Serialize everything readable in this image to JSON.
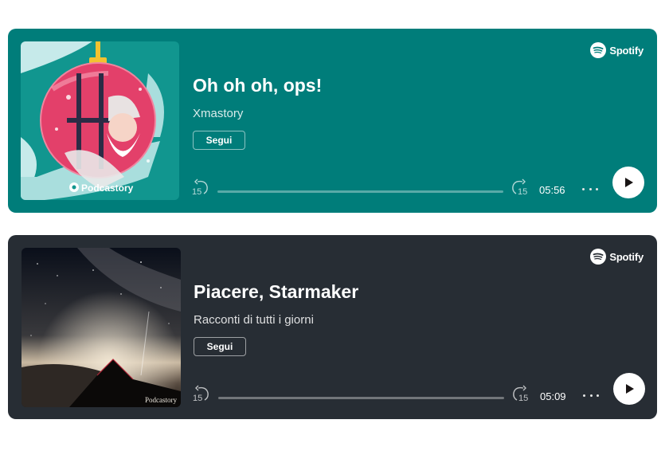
{
  "brand_color": "#1db954",
  "episodes": [
    {
      "title": "Oh oh oh, ops!",
      "show": "Xmastory",
      "follow_label": "Segui",
      "brand_label": "Spotify",
      "duration": "05:56",
      "progress_fraction": 0,
      "cover_caption": "Podcastory",
      "card_color": "#007d7a"
    },
    {
      "title": "Piacere, Starmaker",
      "show": "Racconti di tutti i giorni",
      "follow_label": "Segui",
      "brand_label": "Spotify",
      "duration": "05:09",
      "progress_fraction": 0,
      "cover_caption": "Podcastory",
      "card_color": "#272d34"
    }
  ],
  "skip_seconds": "15"
}
